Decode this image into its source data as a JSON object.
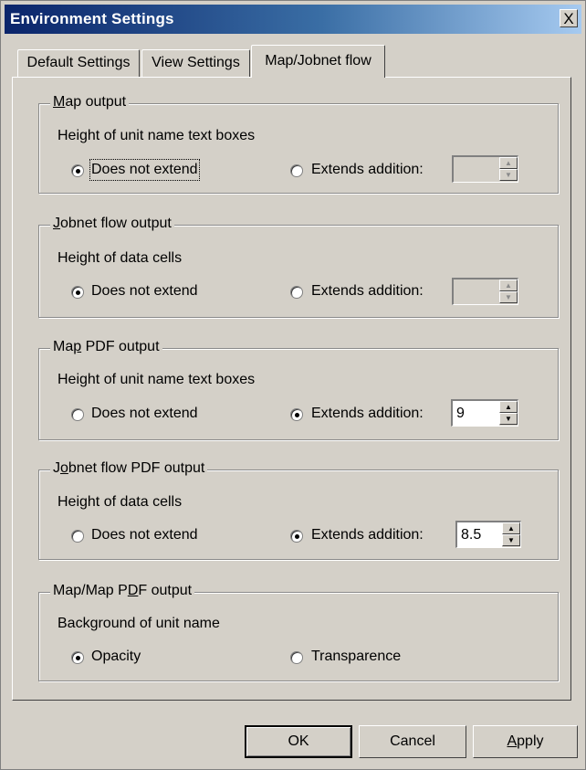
{
  "window": {
    "title": "Environment Settings",
    "close_glyph": "X"
  },
  "tabs": [
    {
      "label": "Default Settings",
      "active": false
    },
    {
      "label": "View Settings",
      "active": false
    },
    {
      "label": "Map/Jobnet flow",
      "active": true
    }
  ],
  "groups": {
    "map_output": {
      "legend_pre": "",
      "legend_key": "M",
      "legend_post": "ap output",
      "sublabel": "Height of unit name text boxes",
      "option1": "Does not extend",
      "option2": "Extends addition:",
      "selected": "option1",
      "spin_value": "",
      "spin_enabled": false
    },
    "jobnet_flow_output": {
      "legend_pre": "",
      "legend_key": "J",
      "legend_post": "obnet flow output",
      "sublabel": "Height of data cells",
      "option1": "Does not extend",
      "option2": "Extends addition:",
      "selected": "option1",
      "spin_value": "",
      "spin_enabled": false
    },
    "map_pdf_output": {
      "legend_pre": "Ma",
      "legend_key": "p",
      "legend_post": " PDF output",
      "sublabel": "Height of unit name text boxes",
      "option1": "Does not extend",
      "option2": "Extends addition:",
      "selected": "option2",
      "spin_value": "9",
      "spin_enabled": true
    },
    "jobnet_flow_pdf_output": {
      "legend_pre": "J",
      "legend_key": "o",
      "legend_post": "bnet flow PDF output",
      "sublabel": "Height of data cells",
      "option1": "Does not extend",
      "option2": "Extends addition:",
      "selected": "option2",
      "spin_value": "8.5",
      "spin_enabled": true
    },
    "map_map_pdf_output": {
      "legend_pre": "Map/Map P",
      "legend_key": "D",
      "legend_post": "F output",
      "sublabel": "Background of unit name",
      "option1": "Opacity",
      "option2": "Transparence",
      "selected": "option1"
    }
  },
  "buttons": {
    "ok": "OK",
    "cancel": "Cancel",
    "apply_key": "A",
    "apply_rest": "pply"
  }
}
